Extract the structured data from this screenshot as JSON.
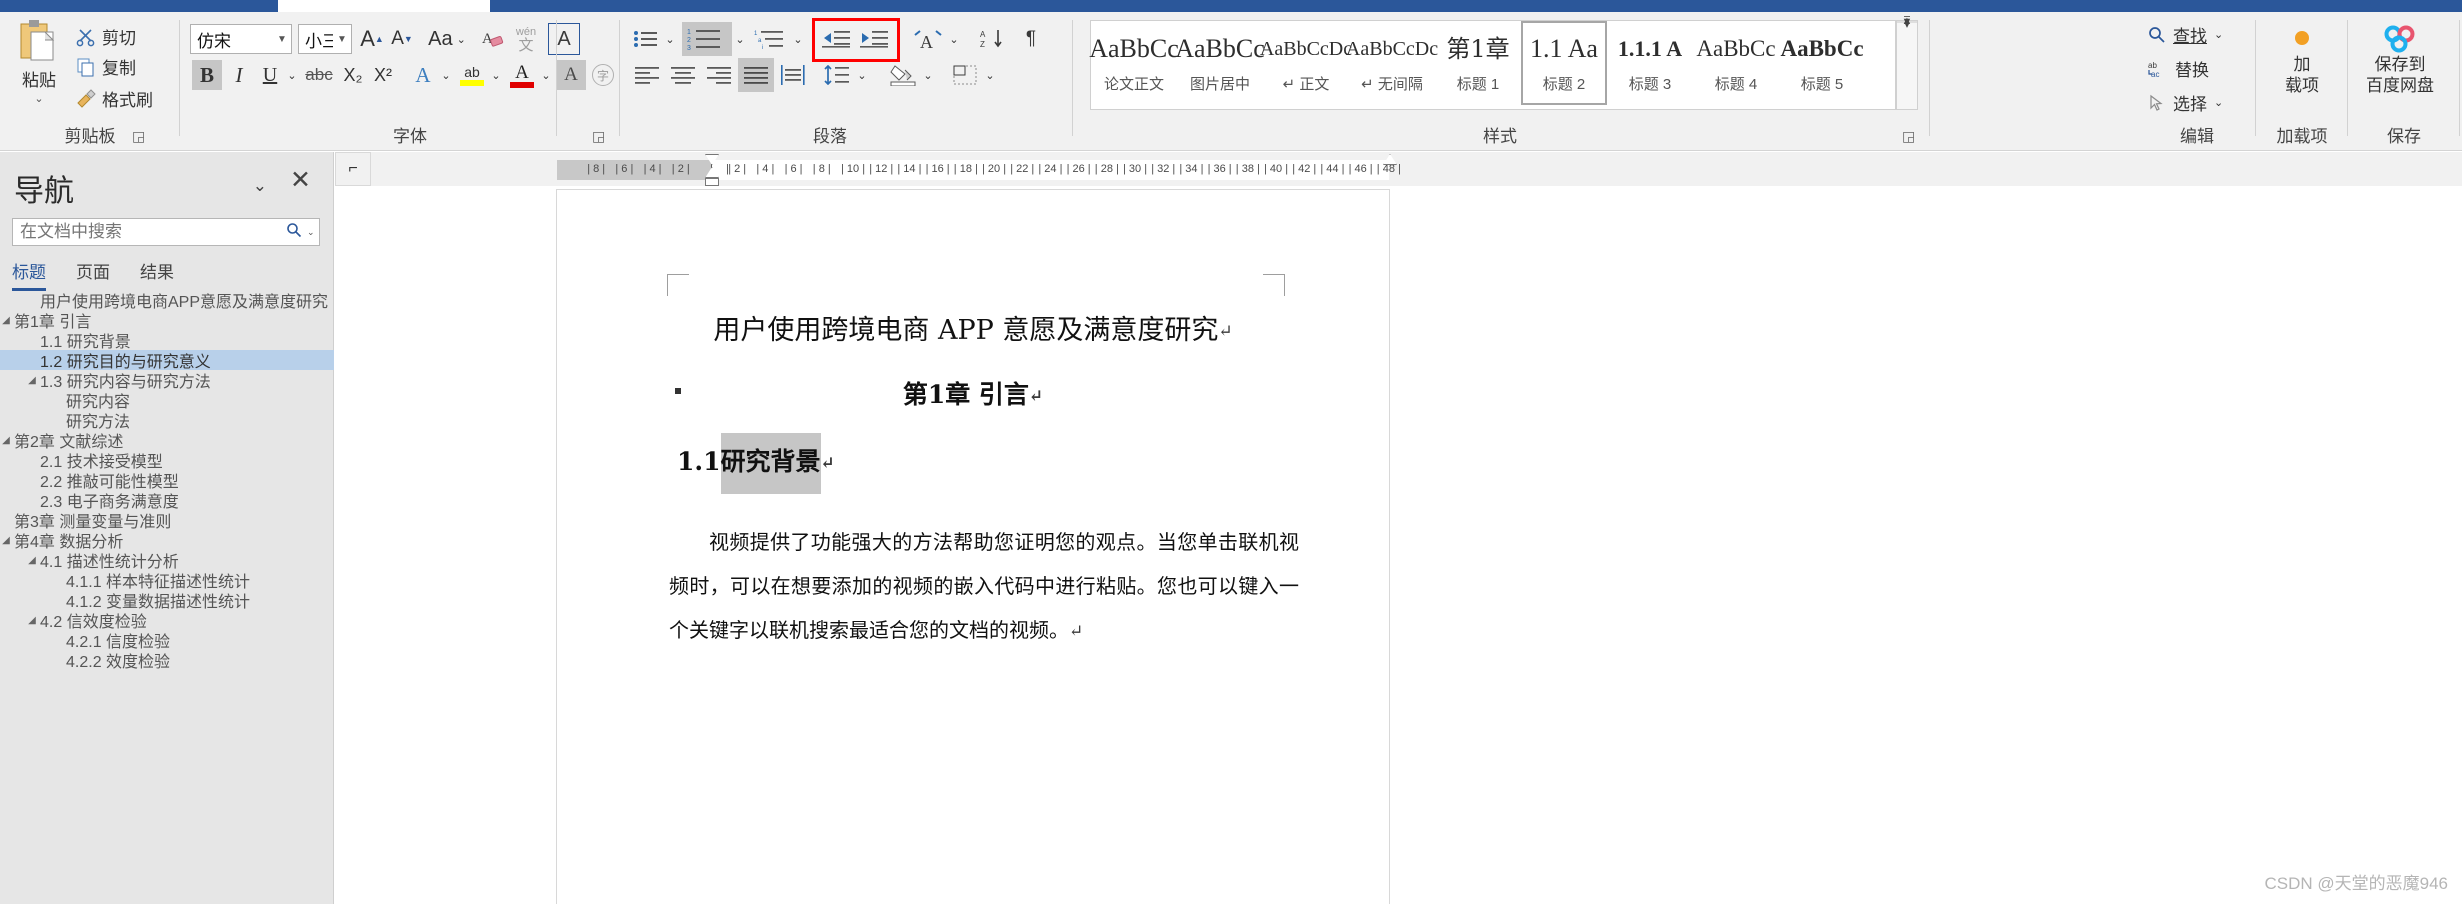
{
  "ribbon": {
    "groups": [
      {
        "id": "clipboard",
        "label": "剪贴板"
      },
      {
        "id": "font",
        "label": "字体"
      },
      {
        "id": "paragraph",
        "label": "段落"
      },
      {
        "id": "styles",
        "label": "样式"
      },
      {
        "id": "editing",
        "label": "编辑"
      },
      {
        "id": "addins",
        "label": "加载项"
      },
      {
        "id": "save",
        "label": "保存"
      }
    ],
    "clipboard": {
      "paste": "粘贴",
      "paste_caret": "⌄",
      "cut": "剪切",
      "copy": "复制",
      "format_painter": "格式刷",
      "launcher": "⌐"
    },
    "font": {
      "font_name": "仿宋",
      "font_size": "小三",
      "grow_font": "A",
      "shrink_font": "A",
      "change_case": "Aa",
      "clear_formatting": "A",
      "phonetic_guide": "wén 文",
      "character_border": "A",
      "bold": "B",
      "italic": "I",
      "underline": "U",
      "strikethrough": "abc",
      "subscript": "X₂",
      "superscript": "X²",
      "text_effects": "A",
      "highlight": "ab",
      "font_color": "A",
      "character_shading": "A",
      "enclose_characters": "字"
    },
    "paragraph": {
      "bullets": "≔",
      "numbering": "123",
      "multilevel": "1a i",
      "decrease_indent": "⇤",
      "increase_indent": "⇥",
      "asian_layout": "A",
      "sort": "AZ↓",
      "show_marks": "¶",
      "align_left": "",
      "align_center": "",
      "align_right": "",
      "justify": "",
      "distributed": "",
      "line_spacing": "↕",
      "shading": "",
      "borders": ""
    },
    "styles": {
      "items": [
        {
          "sample": "AaBbCc",
          "name": "论文正文",
          "active": false,
          "bold": false,
          "size": 25
        },
        {
          "sample": "AaBbCc",
          "name": "图片居中",
          "active": false,
          "bold": false,
          "size": 25
        },
        {
          "sample": "AaBbCcDc",
          "name": "↵ 正文",
          "active": false,
          "bold": false,
          "size": 20
        },
        {
          "sample": "AaBbCcDc",
          "name": "↵ 无间隔",
          "active": false,
          "bold": false,
          "size": 20
        },
        {
          "sample": "第1章",
          "name": "标题 1",
          "active": false,
          "bold": true,
          "size": 24
        },
        {
          "sample": "1.1 Aa",
          "name": "标题 2",
          "active": true,
          "bold": false,
          "size": 25
        },
        {
          "sample": "1.1.1 A",
          "name": "标题 3",
          "active": false,
          "bold": true,
          "size": 22
        },
        {
          "sample": "AaBbCc",
          "name": "标题 4",
          "active": false,
          "bold": false,
          "size": 23
        },
        {
          "sample": "AaBbCc",
          "name": "标题 5",
          "active": false,
          "bold": true,
          "size": 23
        }
      ],
      "scroll_up": "▲",
      "scroll_down": "▼",
      "scroll_more": "▾",
      "launcher": "⌐"
    },
    "editing": {
      "find": "查找",
      "find_caret": "⌄",
      "replace": "替换",
      "replace_icon": "ab ac",
      "select": "选择",
      "select_caret": "⌄"
    },
    "addins": {
      "label": "加\n载项",
      "line1": "加",
      "line2": "载项"
    },
    "save_cloud": {
      "line1": "保存到",
      "line2": "百度网盘"
    }
  },
  "navigation": {
    "title": "导航",
    "collapse_icon": "⌄",
    "close_icon": "✕",
    "search": {
      "placeholder": "在文档中搜索",
      "value": "",
      "icon": "search-icon",
      "caret": "⌄"
    },
    "tabs": [
      {
        "label": "标题",
        "active": true
      },
      {
        "label": "页面",
        "active": false
      },
      {
        "label": "结果",
        "active": false
      }
    ],
    "headings": [
      {
        "label": "用户使用跨境电商APP意愿及满意度研究",
        "indent": 1,
        "tri": "",
        "selected": false
      },
      {
        "label": "第1章 引言",
        "indent": 0,
        "tri": "◢",
        "selected": false
      },
      {
        "label": "1.1 研究背景",
        "indent": 1,
        "tri": "",
        "selected": false
      },
      {
        "label": "1.2 研究目的与研究意义",
        "indent": 1,
        "tri": "",
        "selected": true
      },
      {
        "label": "1.3 研究内容与研究方法",
        "indent": 1,
        "tri": "◢",
        "selected": false
      },
      {
        "label": "研究内容",
        "indent": 2,
        "tri": "",
        "selected": false
      },
      {
        "label": "研究方法",
        "indent": 2,
        "tri": "",
        "selected": false
      },
      {
        "label": "第2章 文献综述",
        "indent": 0,
        "tri": "◢",
        "selected": false
      },
      {
        "label": "2.1 技术接受模型",
        "indent": 1,
        "tri": "",
        "selected": false
      },
      {
        "label": "2.2 推敲可能性模型",
        "indent": 1,
        "tri": "",
        "selected": false
      },
      {
        "label": "2.3 电子商务满意度",
        "indent": 1,
        "tri": "",
        "selected": false
      },
      {
        "label": "第3章 测量变量与准则",
        "indent": 0,
        "tri": "",
        "selected": false
      },
      {
        "label": "第4章 数据分析",
        "indent": 0,
        "tri": "◢",
        "selected": false
      },
      {
        "label": "4.1 描述性统计分析",
        "indent": 1,
        "tri": "◢",
        "selected": false
      },
      {
        "label": "4.1.1 样本特征描述性统计",
        "indent": 2,
        "tri": "",
        "selected": false
      },
      {
        "label": "4.1.2 变量数据描述性统计",
        "indent": 2,
        "tri": "",
        "selected": false
      },
      {
        "label": "4.2 信效度检验",
        "indent": 1,
        "tri": "◢",
        "selected": false
      },
      {
        "label": "4.2.1 信度检验",
        "indent": 2,
        "tri": "",
        "selected": false
      },
      {
        "label": "4.2.2 效度检验",
        "indent": 2,
        "tri": "",
        "selected": false
      }
    ]
  },
  "ruler": {
    "corner_icon": "⌐",
    "left_ticks": [
      "8",
      "6",
      "4",
      "2"
    ],
    "right_ticks": [
      "2",
      "4",
      "6",
      "8",
      "10",
      "12",
      "14",
      "16",
      "18",
      "20",
      "22",
      "24",
      "26",
      "28",
      "30",
      "32",
      "34",
      "36",
      "38",
      "40",
      "42",
      "44",
      "46",
      "48"
    ]
  },
  "document": {
    "title": "用户使用跨境电商 APP 意愿及满意度研究",
    "title_mark": "↵",
    "heading1": "第1章 引言",
    "heading1_mark": "↵",
    "heading2_num": "1.1",
    "heading2_text": "研究背景",
    "heading2_mark": "↵",
    "paragraph": "视频提供了功能强大的方法帮助您证明您的观点。当您单击联机视频时，可以在想要添加的视频的嵌入代码中进行粘贴。您也可以键入一个关键字以联机搜索最适合您的文档的视频。",
    "paragraph_mark": "↵"
  },
  "watermark": "CSDN @天堂的恶魔946"
}
